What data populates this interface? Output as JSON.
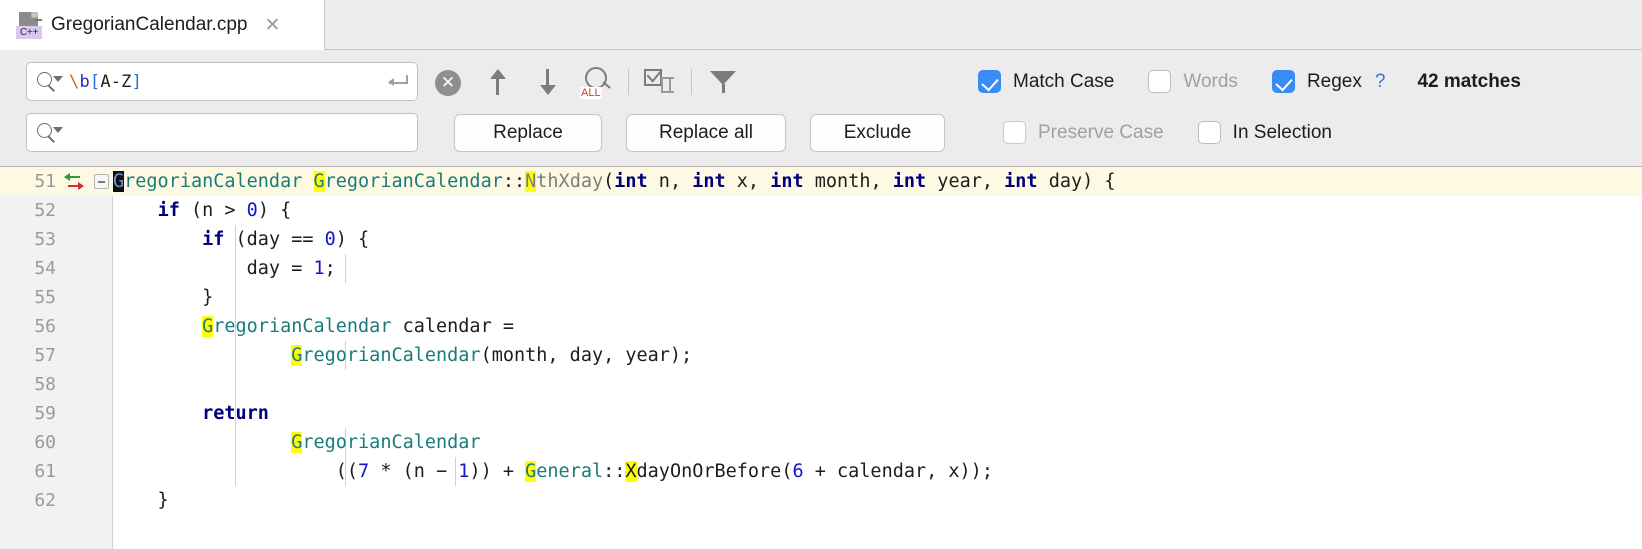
{
  "window": {
    "tab": {
      "filename": "GregorianCalendar.cpp",
      "icon": "cpp-file-icon",
      "badge": "C++",
      "close": "✕"
    }
  },
  "find_panel": {
    "search": {
      "value": "\\b[A-Z]",
      "value_parts": {
        "escape": "\\",
        "cls": "b",
        "open": "[",
        "range": "A-Z",
        "close": "]"
      },
      "enter_icon": "enter-return-icon",
      "clear_icon": "✕",
      "history_icon": "search-history-dropdown-icon"
    },
    "replace": {
      "value": "",
      "placeholder": "",
      "history_icon": "replace-history-dropdown-icon"
    },
    "tools": [
      {
        "name": "find-previous",
        "icon": "arrow-up-icon"
      },
      {
        "name": "find-next",
        "icon": "arrow-down-icon"
      },
      {
        "name": "select-all-occurrences",
        "icon": "select-all-icon",
        "label": "ALL"
      },
      {
        "name": "add-selection-for-next-occurrence",
        "icon": "checkbox-cursor-icon"
      },
      {
        "name": "filter-search-results",
        "icon": "filter-funnel-icon"
      }
    ],
    "options_row1": [
      {
        "label": "Match Case",
        "checked": true,
        "enabled": true
      },
      {
        "label": "Words",
        "checked": false,
        "enabled": false
      },
      {
        "label": "Regex",
        "checked": true,
        "enabled": true
      }
    ],
    "help_label": "?",
    "match_count": "42 matches",
    "buttons": [
      {
        "label": "Replace"
      },
      {
        "label": "Replace all"
      },
      {
        "label": "Exclude"
      }
    ],
    "options_row2": [
      {
        "label": "Preserve Case",
        "checked": false,
        "enabled": false
      },
      {
        "label": "In Selection",
        "checked": false,
        "enabled": true
      }
    ]
  },
  "editor": {
    "language": "C++",
    "highlight_color": "#ffff00",
    "current_line": 51,
    "lines": [
      {
        "num": "51",
        "current": true,
        "gutter_icon": "override-implement-arrows-icon",
        "fold": true,
        "indents": [],
        "tokens": [
          {
            "t": "G",
            "c": "cls caretsel"
          },
          {
            "t": "regorianCalendar ",
            "c": "cls"
          },
          {
            "t": "G",
            "c": "cls hl"
          },
          {
            "t": "regorianCalendar",
            "c": "cls"
          },
          {
            "t": "::",
            "c": "plain"
          },
          {
            "t": "N",
            "c": "fn hl"
          },
          {
            "t": "thXday",
            "c": "fn"
          },
          {
            "t": "(",
            "c": "plain"
          },
          {
            "t": "int",
            "c": "kw"
          },
          {
            "t": " n, ",
            "c": "plain"
          },
          {
            "t": "int",
            "c": "kw"
          },
          {
            "t": " x, ",
            "c": "plain"
          },
          {
            "t": "int",
            "c": "kw"
          },
          {
            "t": " month, ",
            "c": "plain"
          },
          {
            "t": "int",
            "c": "kw"
          },
          {
            "t": " year, ",
            "c": "plain"
          },
          {
            "t": "int",
            "c": "kw"
          },
          {
            "t": " day) {",
            "c": "plain"
          }
        ]
      },
      {
        "num": "52",
        "current": false,
        "indents": [],
        "tokens": [
          {
            "t": "    ",
            "c": "plain"
          },
          {
            "t": "if",
            "c": "kw"
          },
          {
            "t": " (n > ",
            "c": "plain"
          },
          {
            "t": "0",
            "c": "num"
          },
          {
            "t": ") {",
            "c": "plain"
          }
        ]
      },
      {
        "num": "53",
        "current": false,
        "indents": [
          1
        ],
        "tokens": [
          {
            "t": "        ",
            "c": "plain"
          },
          {
            "t": "if",
            "c": "kw"
          },
          {
            "t": " (day == ",
            "c": "plain"
          },
          {
            "t": "0",
            "c": "num"
          },
          {
            "t": ") {",
            "c": "plain"
          }
        ]
      },
      {
        "num": "54",
        "current": false,
        "indents": [
          1,
          2
        ],
        "tokens": [
          {
            "t": "            day = ",
            "c": "plain"
          },
          {
            "t": "1",
            "c": "num"
          },
          {
            "t": ";",
            "c": "plain"
          }
        ]
      },
      {
        "num": "55",
        "current": false,
        "indents": [
          1
        ],
        "tokens": [
          {
            "t": "        }",
            "c": "plain"
          }
        ]
      },
      {
        "num": "56",
        "current": false,
        "indents": [
          1
        ],
        "tokens": [
          {
            "t": "        ",
            "c": "plain"
          },
          {
            "t": "G",
            "c": "cls hl"
          },
          {
            "t": "regorianCalendar",
            "c": "cls"
          },
          {
            "t": " calendar =",
            "c": "plain"
          }
        ]
      },
      {
        "num": "57",
        "current": false,
        "indents": [
          1,
          2
        ],
        "tokens": [
          {
            "t": "                ",
            "c": "plain"
          },
          {
            "t": "G",
            "c": "cls hl"
          },
          {
            "t": "regorianCalendar",
            "c": "cls"
          },
          {
            "t": "(month, day, year);",
            "c": "plain"
          }
        ]
      },
      {
        "num": "58",
        "current": false,
        "indents": [
          1
        ],
        "tokens": [
          {
            "t": "",
            "c": "plain"
          }
        ]
      },
      {
        "num": "59",
        "current": false,
        "indents": [
          1
        ],
        "tokens": [
          {
            "t": "        ",
            "c": "plain"
          },
          {
            "t": "return",
            "c": "kw"
          }
        ]
      },
      {
        "num": "60",
        "current": false,
        "indents": [
          1,
          2
        ],
        "tokens": [
          {
            "t": "                ",
            "c": "plain"
          },
          {
            "t": "G",
            "c": "cls hl"
          },
          {
            "t": "regorianCalendar",
            "c": "cls"
          }
        ]
      },
      {
        "num": "61",
        "current": false,
        "indents": [
          1,
          2,
          3
        ],
        "tokens": [
          {
            "t": "                    ((",
            "c": "plain"
          },
          {
            "t": "7",
            "c": "num"
          },
          {
            "t": " * (n − ",
            "c": "plain"
          },
          {
            "t": "1",
            "c": "num"
          },
          {
            "t": ")) + ",
            "c": "plain"
          },
          {
            "t": "G",
            "c": "cls hl"
          },
          {
            "t": "eneral",
            "c": "cls"
          },
          {
            "t": "::",
            "c": "plain"
          },
          {
            "t": "X",
            "c": "plain hl"
          },
          {
            "t": "dayOnOrBefore(",
            "c": "plain"
          },
          {
            "t": "6",
            "c": "num"
          },
          {
            "t": " + calendar, x));",
            "c": "plain"
          }
        ]
      },
      {
        "num": "62",
        "current": false,
        "indents": [],
        "tokens": [
          {
            "t": "    }",
            "c": "plain"
          }
        ]
      }
    ]
  }
}
